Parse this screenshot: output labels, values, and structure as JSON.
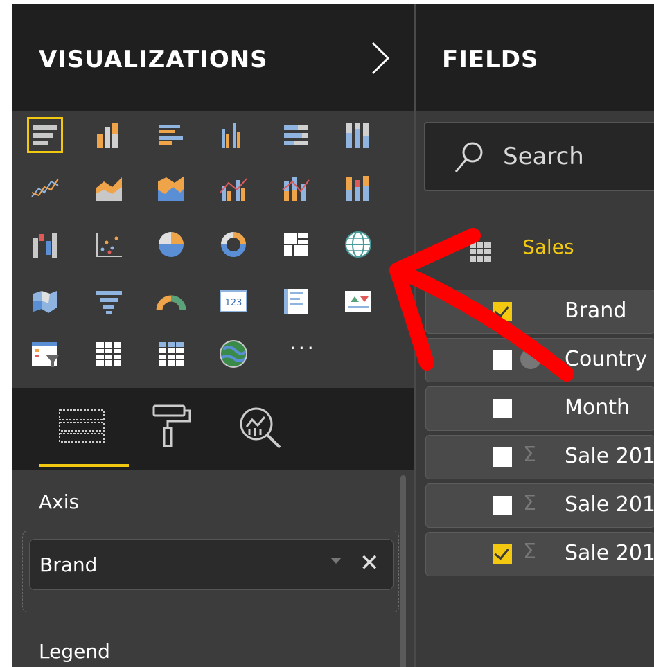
{
  "visualizations": {
    "title": "VISUALIZATIONS",
    "collapse_icon": "chevron-right-icon",
    "gallery_icons": [
      "stacked-bar-chart-icon",
      "stacked-column-chart-icon",
      "clustered-bar-chart-icon",
      "clustered-column-chart-icon",
      "100-stacked-bar-chart-icon",
      "100-stacked-column-chart-icon",
      "line-chart-icon",
      "area-chart-icon",
      "stacked-area-chart-icon",
      "line-clustered-column-chart-icon",
      "line-stacked-column-chart-icon",
      "ribbon-chart-icon",
      "waterfall-chart-icon",
      "scatter-chart-icon",
      "pie-chart-icon",
      "donut-chart-icon",
      "treemap-icon",
      "map-icon",
      "filled-map-icon",
      "funnel-icon",
      "gauge-icon",
      "card-icon",
      "multi-row-card-icon",
      "kpi-icon",
      "slicer-icon",
      "table-icon",
      "matrix-icon",
      "arcgis-map-icon"
    ],
    "more_label": "···",
    "subtabs": [
      "fields-well-icon",
      "format-paint-roller-icon",
      "analytics-magnifier-icon"
    ],
    "wells": {
      "axis_label": "Axis",
      "axis_field": "Brand",
      "legend_label": "Legend"
    }
  },
  "fields": {
    "title": "FIELDS",
    "search_placeholder": "Search",
    "table_name": "Sales",
    "items": [
      {
        "label": "Brand",
        "checked": true,
        "type": "text"
      },
      {
        "label": "Country",
        "checked": false,
        "type": "geo"
      },
      {
        "label": "Month",
        "checked": false,
        "type": "text"
      },
      {
        "label": "Sale 201",
        "checked": false,
        "type": "sum"
      },
      {
        "label": "Sale 201",
        "checked": false,
        "type": "sum"
      },
      {
        "label": "Sale 201",
        "checked": true,
        "type": "sum"
      }
    ]
  },
  "colors": {
    "accent": "#f2c811",
    "panel_dark": "#1f1f1f",
    "panel": "#3a3a3a",
    "annotation_arrow": "#ff0000"
  }
}
